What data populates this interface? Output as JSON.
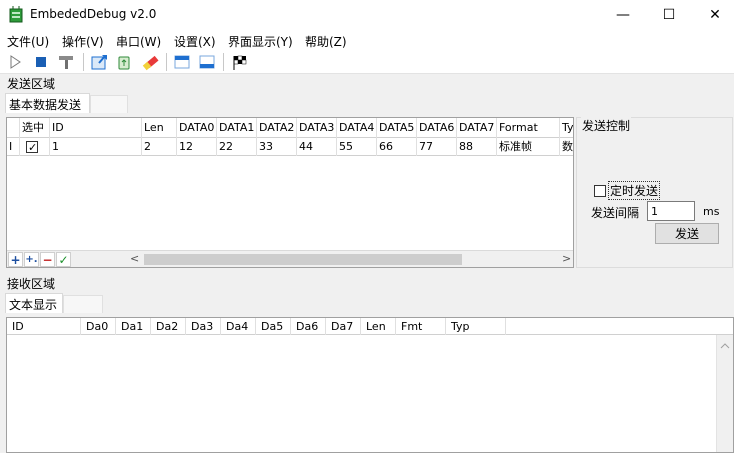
{
  "window": {
    "title": "EmbededDebug v2.0",
    "minimize": "—",
    "maximize": "☐",
    "close": "✕"
  },
  "menu": [
    "文件(U)",
    "操作(V)",
    "串口(W)",
    "设置(X)",
    "界面显示(Y)",
    "帮助(Z)"
  ],
  "toolbar": {
    "icons": [
      "play-icon",
      "stop-icon",
      "hammer-icon",
      "export-icon",
      "recycle-icon",
      "eraser-icon",
      "panel-top-icon",
      "panel-bottom-icon",
      "flag-icon"
    ]
  },
  "send_section": {
    "label": "发送区域",
    "tab": "基本数据发送",
    "columns": [
      "选中",
      "ID",
      "Len",
      "DATA0",
      "DATA1",
      "DATA2",
      "DATA3",
      "DATA4",
      "DATA5",
      "DATA6",
      "DATA7",
      "Format",
      "Ty"
    ],
    "rows": [
      {
        "marker": "I",
        "selected": true,
        "id": "1",
        "len": "2",
        "data": [
          "12",
          "22",
          "33",
          "44",
          "55",
          "66",
          "77",
          "88"
        ],
        "format": "标准帧",
        "type": "数"
      }
    ],
    "bottom_buttons": [
      "+",
      "+.",
      "−",
      "✓"
    ]
  },
  "send_control": {
    "title": "发送控制",
    "timed_send_label": "定时发送",
    "timed_send_checked": false,
    "interval_label": "发送间隔",
    "interval_value": "1",
    "interval_unit": "ms",
    "send_button": "发送"
  },
  "receive_section": {
    "label": "接收区域",
    "tab": "文本显示",
    "columns": [
      "ID",
      "Da0",
      "Da1",
      "Da2",
      "Da3",
      "Da4",
      "Da5",
      "Da6",
      "Da7",
      "Len",
      "Fmt",
      "Typ"
    ]
  },
  "colors": {
    "accent_blue": "#1e6fd0",
    "stop_blue": "#1a5fb4",
    "add_green": "#1a8f2a",
    "remove_red": "#c02020"
  }
}
